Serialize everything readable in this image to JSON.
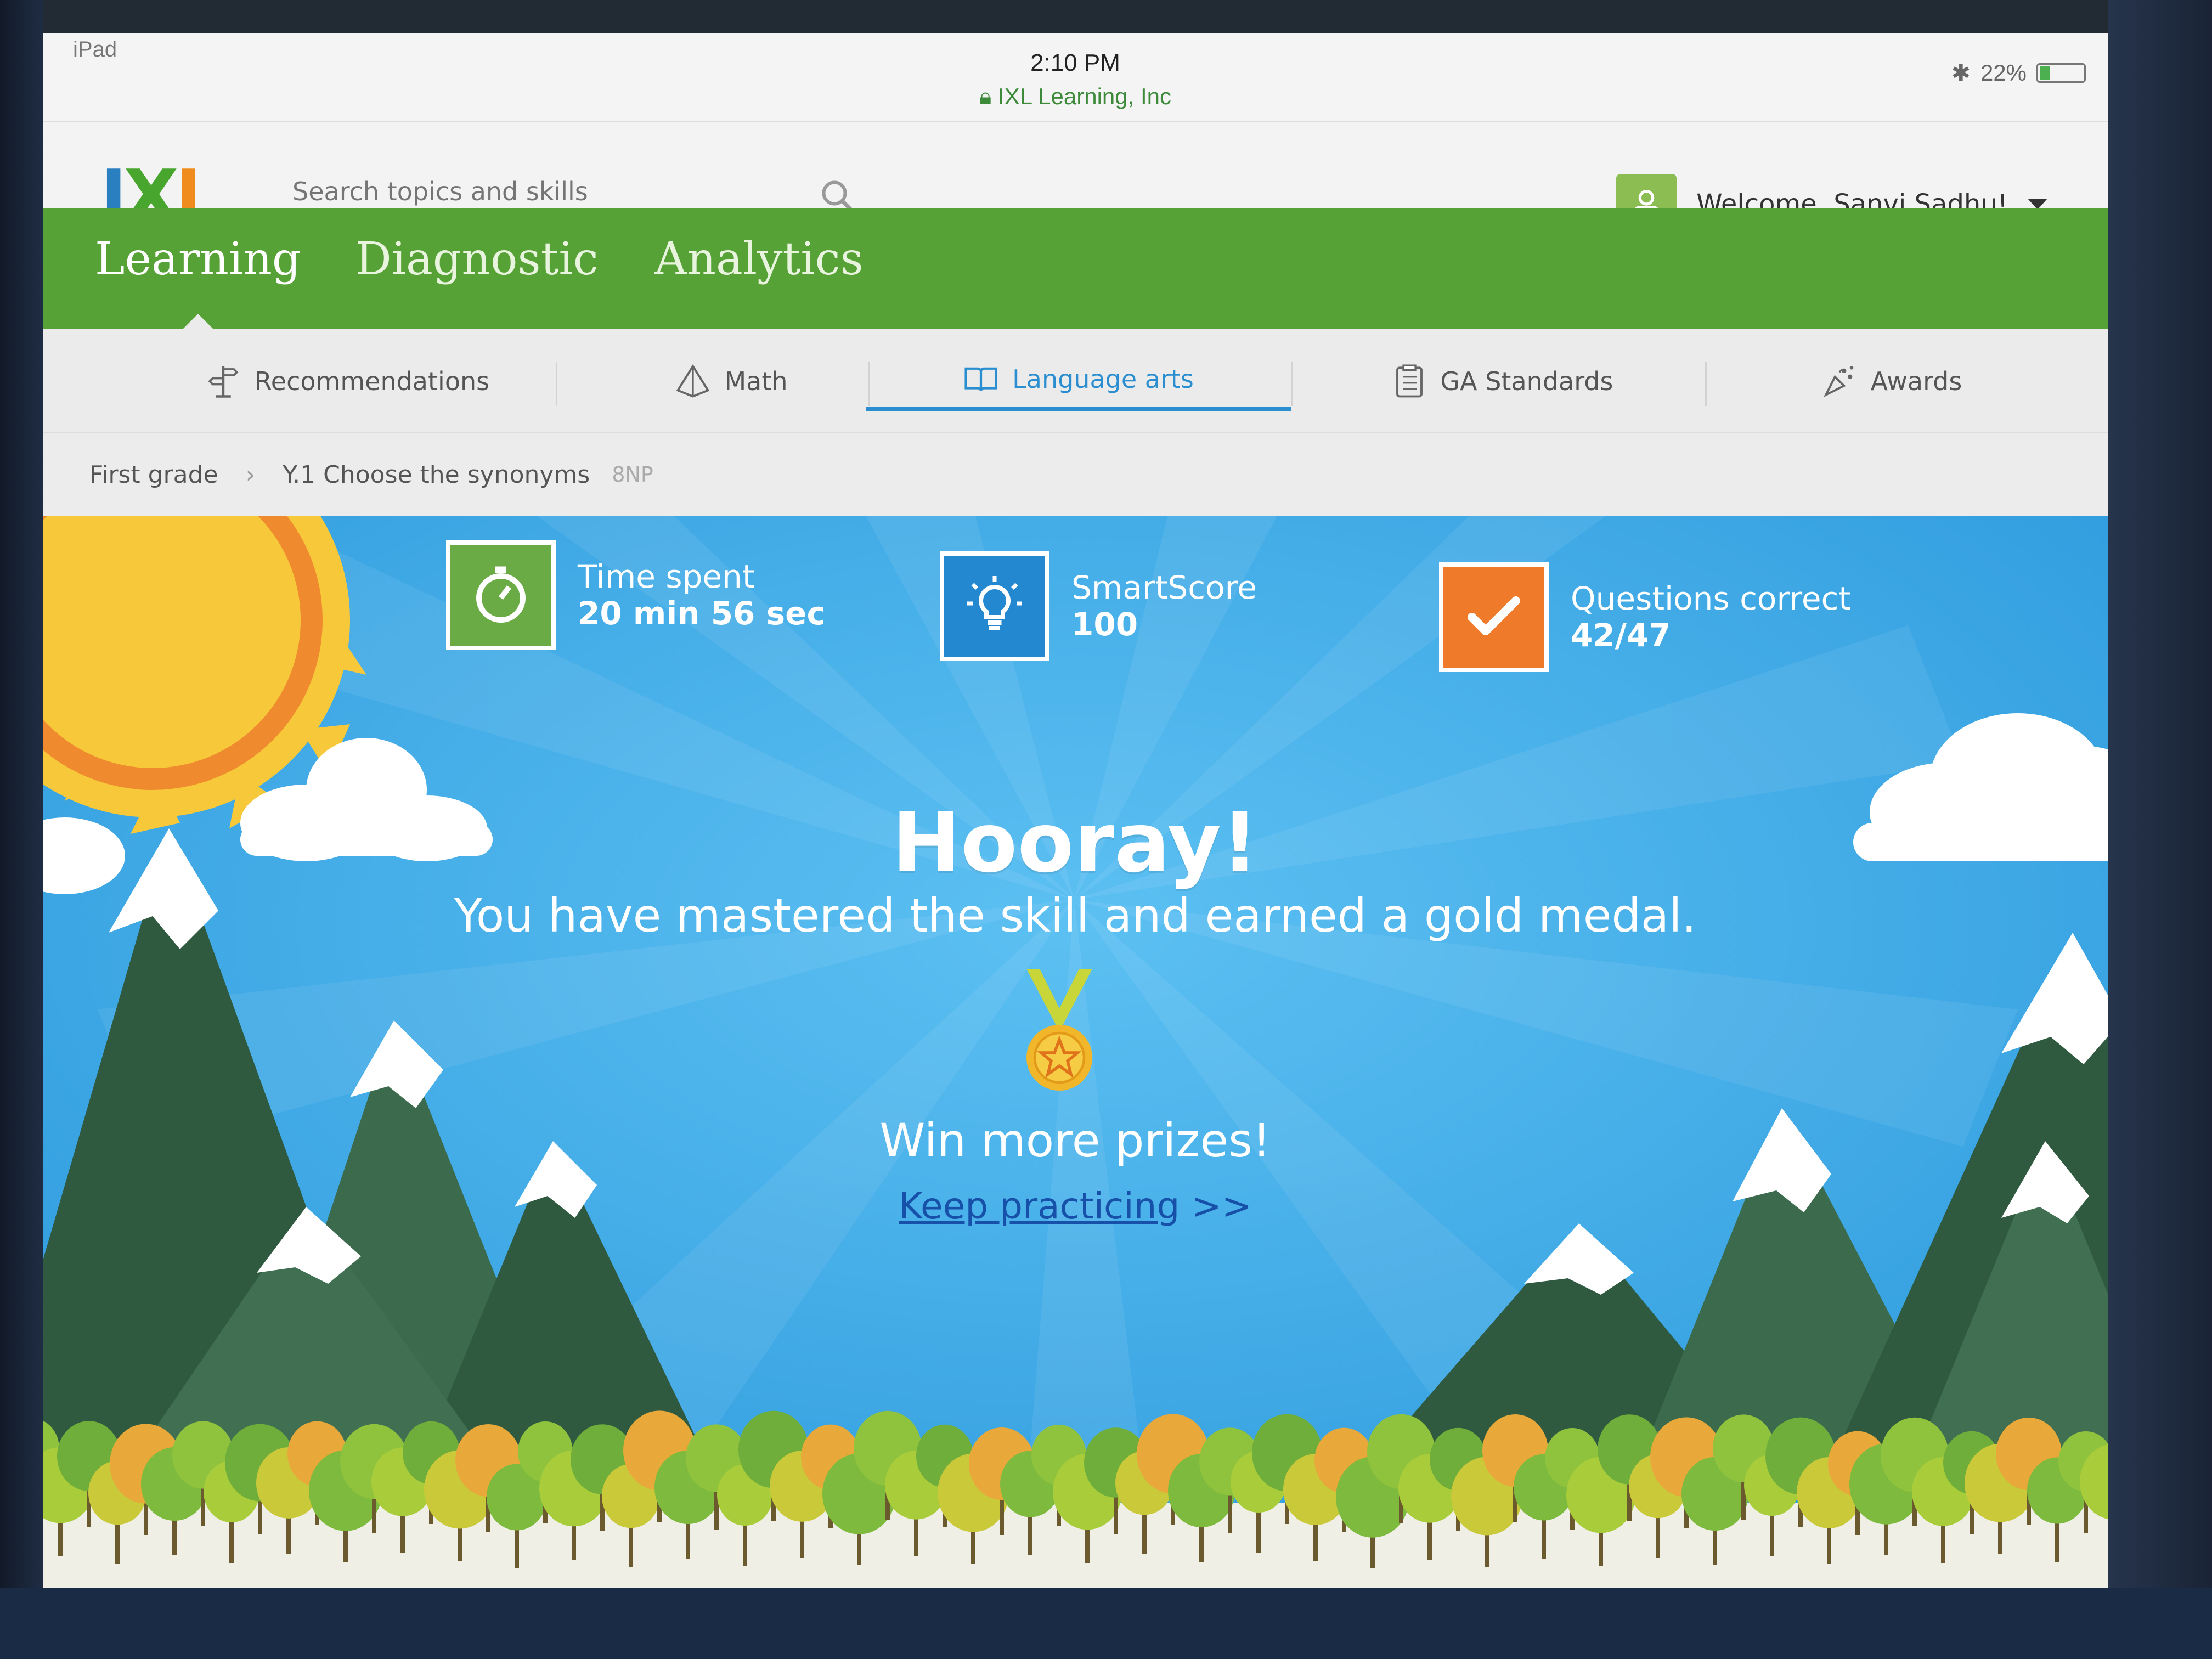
{
  "status_bar": {
    "device": "iPad",
    "time": "2:10 PM",
    "site": "IXL Learning, Inc",
    "battery": "22%"
  },
  "header": {
    "logo": {
      "i": "I",
      "x": "X",
      "l": "L"
    },
    "search_placeholder": "Search topics and skills",
    "welcome": "Welcome, Sanvi Sadhu!"
  },
  "main_nav": {
    "tabs": [
      {
        "label": "Learning"
      },
      {
        "label": "Diagnostic"
      },
      {
        "label": "Analytics"
      }
    ],
    "active": "Learning"
  },
  "subject_nav": {
    "tabs": [
      {
        "label": "Recommendations",
        "icon": "signpost-icon"
      },
      {
        "label": "Math",
        "icon": "pyramid-icon"
      },
      {
        "label": "Language arts",
        "icon": "book-icon"
      },
      {
        "label": "GA Standards",
        "icon": "clipboard-icon"
      },
      {
        "label": "Awards",
        "icon": "awards-icon"
      }
    ],
    "active": "Language arts"
  },
  "breadcrumb": {
    "grade": "First grade",
    "skill": "Y.1 Choose the synonyms",
    "code": "8NP"
  },
  "stats": {
    "time": {
      "label": "Time spent",
      "value": "20 min  56 sec",
      "color": "#6aab45",
      "icon": "stopwatch-icon"
    },
    "smartscore": {
      "label": "SmartScore",
      "value": "100",
      "color": "#2388cf",
      "icon": "lightbulb-icon"
    },
    "questions": {
      "label": "Questions correct",
      "value": "42/47",
      "color": "#ef7b2a",
      "icon": "checkmark-icon"
    }
  },
  "celebration": {
    "title": "Hooray!",
    "message": "You have mastered the skill and earned a gold medal.",
    "prompt": "Win more prizes!",
    "link": "Keep practicing",
    "link_suffix": ">>"
  },
  "colors": {
    "brand_green": "#57a237",
    "sky": "#35a3e4",
    "active_tab_blue": "#2a8ed0",
    "medal_gold": "#f2b62a"
  }
}
